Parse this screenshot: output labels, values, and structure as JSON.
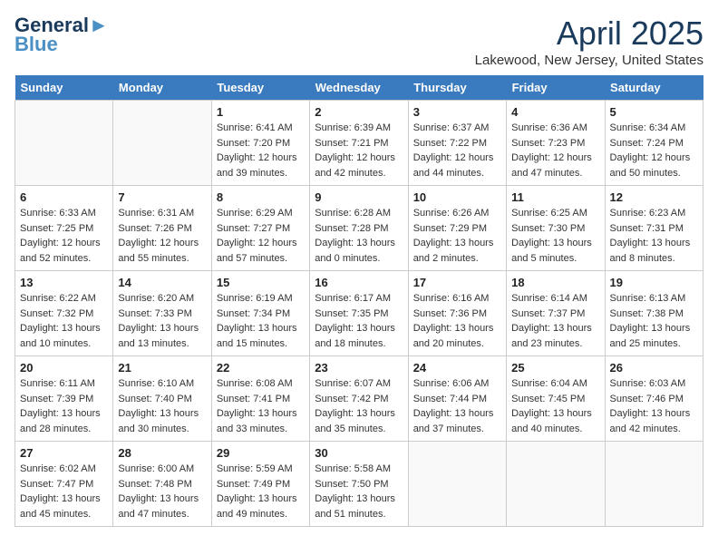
{
  "header": {
    "logo_line1": "General",
    "logo_line2": "Blue",
    "month_title": "April 2025",
    "location": "Lakewood, New Jersey, United States"
  },
  "days_of_week": [
    "Sunday",
    "Monday",
    "Tuesday",
    "Wednesday",
    "Thursday",
    "Friday",
    "Saturday"
  ],
  "weeks": [
    [
      {
        "day": "",
        "sunrise": "",
        "sunset": "",
        "daylight": ""
      },
      {
        "day": "",
        "sunrise": "",
        "sunset": "",
        "daylight": ""
      },
      {
        "day": "1",
        "sunrise": "Sunrise: 6:41 AM",
        "sunset": "Sunset: 7:20 PM",
        "daylight": "Daylight: 12 hours and 39 minutes."
      },
      {
        "day": "2",
        "sunrise": "Sunrise: 6:39 AM",
        "sunset": "Sunset: 7:21 PM",
        "daylight": "Daylight: 12 hours and 42 minutes."
      },
      {
        "day": "3",
        "sunrise": "Sunrise: 6:37 AM",
        "sunset": "Sunset: 7:22 PM",
        "daylight": "Daylight: 12 hours and 44 minutes."
      },
      {
        "day": "4",
        "sunrise": "Sunrise: 6:36 AM",
        "sunset": "Sunset: 7:23 PM",
        "daylight": "Daylight: 12 hours and 47 minutes."
      },
      {
        "day": "5",
        "sunrise": "Sunrise: 6:34 AM",
        "sunset": "Sunset: 7:24 PM",
        "daylight": "Daylight: 12 hours and 50 minutes."
      }
    ],
    [
      {
        "day": "6",
        "sunrise": "Sunrise: 6:33 AM",
        "sunset": "Sunset: 7:25 PM",
        "daylight": "Daylight: 12 hours and 52 minutes."
      },
      {
        "day": "7",
        "sunrise": "Sunrise: 6:31 AM",
        "sunset": "Sunset: 7:26 PM",
        "daylight": "Daylight: 12 hours and 55 minutes."
      },
      {
        "day": "8",
        "sunrise": "Sunrise: 6:29 AM",
        "sunset": "Sunset: 7:27 PM",
        "daylight": "Daylight: 12 hours and 57 minutes."
      },
      {
        "day": "9",
        "sunrise": "Sunrise: 6:28 AM",
        "sunset": "Sunset: 7:28 PM",
        "daylight": "Daylight: 13 hours and 0 minutes."
      },
      {
        "day": "10",
        "sunrise": "Sunrise: 6:26 AM",
        "sunset": "Sunset: 7:29 PM",
        "daylight": "Daylight: 13 hours and 2 minutes."
      },
      {
        "day": "11",
        "sunrise": "Sunrise: 6:25 AM",
        "sunset": "Sunset: 7:30 PM",
        "daylight": "Daylight: 13 hours and 5 minutes."
      },
      {
        "day": "12",
        "sunrise": "Sunrise: 6:23 AM",
        "sunset": "Sunset: 7:31 PM",
        "daylight": "Daylight: 13 hours and 8 minutes."
      }
    ],
    [
      {
        "day": "13",
        "sunrise": "Sunrise: 6:22 AM",
        "sunset": "Sunset: 7:32 PM",
        "daylight": "Daylight: 13 hours and 10 minutes."
      },
      {
        "day": "14",
        "sunrise": "Sunrise: 6:20 AM",
        "sunset": "Sunset: 7:33 PM",
        "daylight": "Daylight: 13 hours and 13 minutes."
      },
      {
        "day": "15",
        "sunrise": "Sunrise: 6:19 AM",
        "sunset": "Sunset: 7:34 PM",
        "daylight": "Daylight: 13 hours and 15 minutes."
      },
      {
        "day": "16",
        "sunrise": "Sunrise: 6:17 AM",
        "sunset": "Sunset: 7:35 PM",
        "daylight": "Daylight: 13 hours and 18 minutes."
      },
      {
        "day": "17",
        "sunrise": "Sunrise: 6:16 AM",
        "sunset": "Sunset: 7:36 PM",
        "daylight": "Daylight: 13 hours and 20 minutes."
      },
      {
        "day": "18",
        "sunrise": "Sunrise: 6:14 AM",
        "sunset": "Sunset: 7:37 PM",
        "daylight": "Daylight: 13 hours and 23 minutes."
      },
      {
        "day": "19",
        "sunrise": "Sunrise: 6:13 AM",
        "sunset": "Sunset: 7:38 PM",
        "daylight": "Daylight: 13 hours and 25 minutes."
      }
    ],
    [
      {
        "day": "20",
        "sunrise": "Sunrise: 6:11 AM",
        "sunset": "Sunset: 7:39 PM",
        "daylight": "Daylight: 13 hours and 28 minutes."
      },
      {
        "day": "21",
        "sunrise": "Sunrise: 6:10 AM",
        "sunset": "Sunset: 7:40 PM",
        "daylight": "Daylight: 13 hours and 30 minutes."
      },
      {
        "day": "22",
        "sunrise": "Sunrise: 6:08 AM",
        "sunset": "Sunset: 7:41 PM",
        "daylight": "Daylight: 13 hours and 33 minutes."
      },
      {
        "day": "23",
        "sunrise": "Sunrise: 6:07 AM",
        "sunset": "Sunset: 7:42 PM",
        "daylight": "Daylight: 13 hours and 35 minutes."
      },
      {
        "day": "24",
        "sunrise": "Sunrise: 6:06 AM",
        "sunset": "Sunset: 7:44 PM",
        "daylight": "Daylight: 13 hours and 37 minutes."
      },
      {
        "day": "25",
        "sunrise": "Sunrise: 6:04 AM",
        "sunset": "Sunset: 7:45 PM",
        "daylight": "Daylight: 13 hours and 40 minutes."
      },
      {
        "day": "26",
        "sunrise": "Sunrise: 6:03 AM",
        "sunset": "Sunset: 7:46 PM",
        "daylight": "Daylight: 13 hours and 42 minutes."
      }
    ],
    [
      {
        "day": "27",
        "sunrise": "Sunrise: 6:02 AM",
        "sunset": "Sunset: 7:47 PM",
        "daylight": "Daylight: 13 hours and 45 minutes."
      },
      {
        "day": "28",
        "sunrise": "Sunrise: 6:00 AM",
        "sunset": "Sunset: 7:48 PM",
        "daylight": "Daylight: 13 hours and 47 minutes."
      },
      {
        "day": "29",
        "sunrise": "Sunrise: 5:59 AM",
        "sunset": "Sunset: 7:49 PM",
        "daylight": "Daylight: 13 hours and 49 minutes."
      },
      {
        "day": "30",
        "sunrise": "Sunrise: 5:58 AM",
        "sunset": "Sunset: 7:50 PM",
        "daylight": "Daylight: 13 hours and 51 minutes."
      },
      {
        "day": "",
        "sunrise": "",
        "sunset": "",
        "daylight": ""
      },
      {
        "day": "",
        "sunrise": "",
        "sunset": "",
        "daylight": ""
      },
      {
        "day": "",
        "sunrise": "",
        "sunset": "",
        "daylight": ""
      }
    ]
  ]
}
